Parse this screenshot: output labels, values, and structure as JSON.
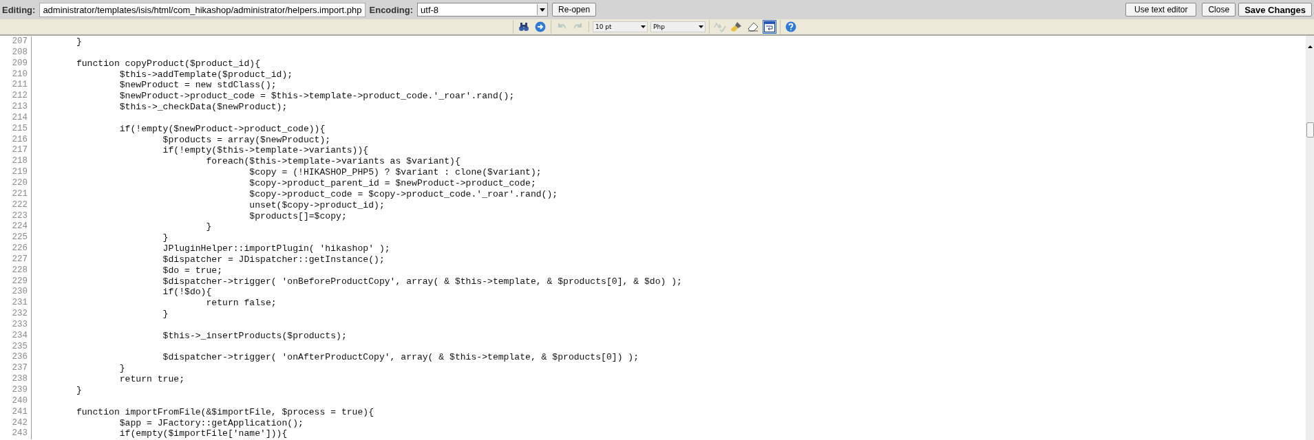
{
  "top_bar": {
    "editing_label": "Editing:",
    "file_path": "administrator/templates/isis/html/com_hikashop/administrator/helpers.import.php",
    "encoding_label": "Encoding:",
    "encoding": "utf-8",
    "reopen_button": "Re-open",
    "buttons": [
      {
        "label": "Use text editor",
        "primary": false
      },
      {
        "label": "Close",
        "primary": false
      },
      {
        "label": "Save Changes",
        "primary": true
      }
    ]
  },
  "toolbar": {
    "groups": [
      {
        "items": [
          {
            "kind": "search",
            "disabled": false,
            "pressed": false
          },
          {
            "kind": "goto",
            "disabled": false,
            "pressed": false
          }
        ]
      },
      {
        "items": [
          {
            "kind": "undo",
            "disabled": true,
            "pressed": false
          },
          {
            "kind": "redo",
            "disabled": true,
            "pressed": false
          }
        ]
      },
      {
        "items": [
          {
            "kind": "select",
            "value": "10 pt"
          },
          {
            "kind": "select",
            "value": "Php"
          }
        ]
      },
      {
        "items": [
          {
            "kind": "spellcheck",
            "disabled": true,
            "pressed": false
          },
          {
            "kind": "highlight",
            "disabled": false,
            "pressed": false
          },
          {
            "kind": "eraser",
            "disabled": false,
            "pressed": false
          },
          {
            "kind": "wrap",
            "disabled": false,
            "pressed": true
          }
        ]
      },
      {
        "items": [
          {
            "kind": "help",
            "disabled": false,
            "pressed": false
          }
        ]
      }
    ]
  },
  "code": {
    "lines": [
      {
        "number": "207",
        "text": "\t}"
      },
      {
        "number": "208"
      },
      {
        "number": "209",
        "text": "\tfunction copyProduct($product_id){"
      },
      {
        "number": "210",
        "text": "\t\t$this->addTemplate($product_id);"
      },
      {
        "number": "211",
        "text": "\t\t$newProduct = new stdClass();"
      },
      {
        "number": "212",
        "text": "\t\t$newProduct->product_code = $this->template->product_code.'_roar'.rand();"
      },
      {
        "number": "213",
        "text": "\t\t$this->_checkData($newProduct);"
      },
      {
        "number": "214"
      },
      {
        "number": "215",
        "text": "\t\tif(!empty($newProduct->product_code)){"
      },
      {
        "number": "216",
        "text": "\t\t\t$products = array($newProduct);"
      },
      {
        "number": "217",
        "text": "\t\t\tif(!empty($this->template->variants)){"
      },
      {
        "number": "218",
        "text": "\t\t\t\tforeach($this->template->variants as $variant){"
      },
      {
        "number": "219",
        "text": "\t\t\t\t\t$copy = (!HIKASHOP_PHP5) ? $variant : clone($variant);"
      },
      {
        "number": "220",
        "text": "\t\t\t\t\t$copy->product_parent_id = $newProduct->product_code;"
      },
      {
        "number": "221",
        "text": "\t\t\t\t\t$copy->product_code = $copy->product_code.'_roar'.rand();"
      },
      {
        "number": "222",
        "text": "\t\t\t\t\tunset($copy->product_id);"
      },
      {
        "number": "223",
        "text": "\t\t\t\t\t$products[]=$copy;"
      },
      {
        "number": "224",
        "text": "\t\t\t\t}"
      },
      {
        "number": "225",
        "text": "\t\t\t}"
      },
      {
        "number": "226",
        "text": "\t\t\tJPluginHelper::importPlugin( 'hikashop' );"
      },
      {
        "number": "227",
        "text": "\t\t\t$dispatcher = JDispatcher::getInstance();"
      },
      {
        "number": "228",
        "text": "\t\t\t$do = true;"
      },
      {
        "number": "229",
        "text": "\t\t\t$dispatcher->trigger( 'onBeforeProductCopy', array( & $this->template, & $products[0], & $do) );"
      },
      {
        "number": "230",
        "text": "\t\t\tif(!$do){"
      },
      {
        "number": "231",
        "text": "\t\t\t\treturn false;"
      },
      {
        "number": "232",
        "text": "\t\t\t}"
      },
      {
        "number": "233"
      },
      {
        "number": "234",
        "text": "\t\t\t$this->_insertProducts($products);"
      },
      {
        "number": "235"
      },
      {
        "number": "236",
        "text": "\t\t\t$dispatcher->trigger( 'onAfterProductCopy', array( & $this->template, & $products[0]) );"
      },
      {
        "number": "237",
        "text": "\t\t}"
      },
      {
        "number": "238",
        "text": "\t\treturn true;"
      },
      {
        "number": "239",
        "text": "\t}"
      },
      {
        "number": "240"
      },
      {
        "number": "241",
        "text": "\tfunction importFromFile(&$importFile, $process = true){"
      },
      {
        "number": "242",
        "text": "\t\t$app = JFactory::getApplication();"
      },
      {
        "number": "243",
        "text": "\t\tif(empty($importFile['name'])){"
      }
    ]
  }
}
